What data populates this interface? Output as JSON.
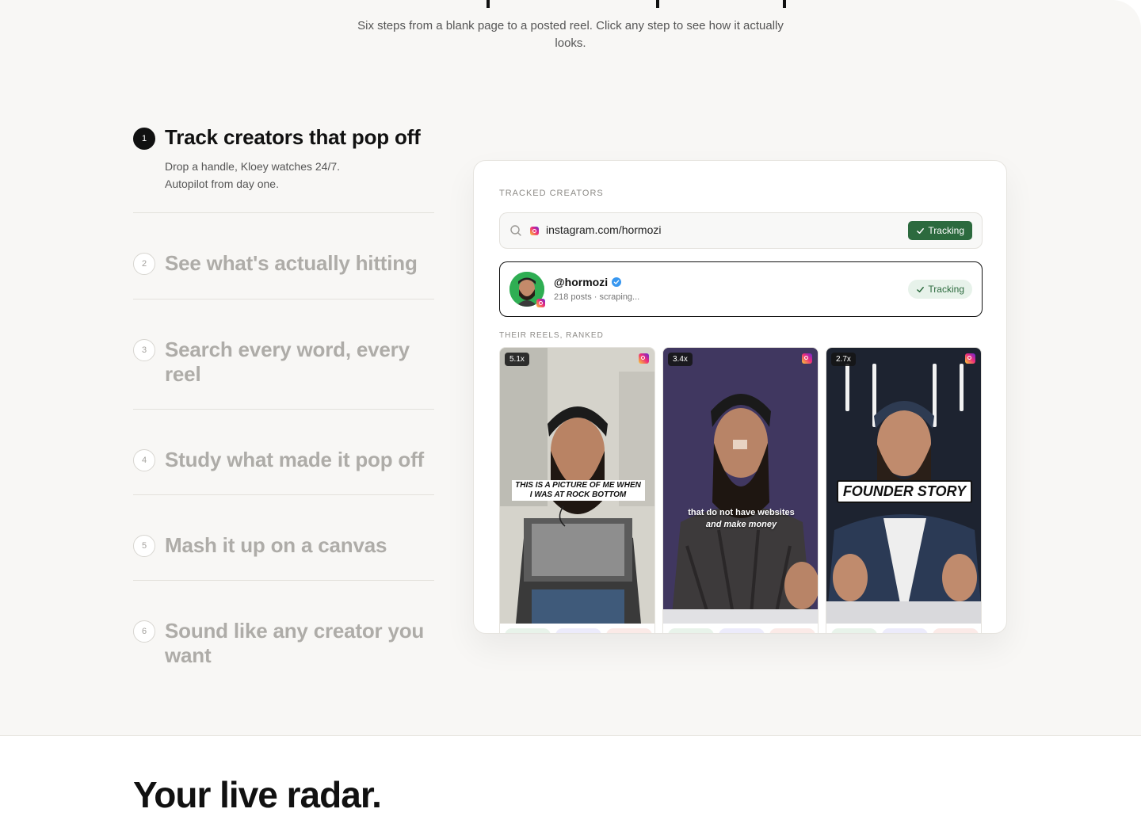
{
  "header": {
    "subtitle": "Six steps from a blank page to a posted reel. Click any step to see how it actually looks."
  },
  "steps": [
    {
      "num": "1",
      "title": "Track creators that pop off",
      "desc_line1": "Drop a handle, Kloey watches 24/7.",
      "desc_line2": "Autopilot from day one.",
      "active": true
    },
    {
      "num": "2",
      "title": "See what's actually hitting"
    },
    {
      "num": "3",
      "title": "Search every word, every reel"
    },
    {
      "num": "4",
      "title": "Study what made it pop off"
    },
    {
      "num": "5",
      "title": "Mash it up on a canvas"
    },
    {
      "num": "6",
      "title": "Sound like any creator you want"
    }
  ],
  "panel": {
    "label": "TRACKED CREATORS",
    "search_value": "instagram.com/hormozi",
    "search_badge": "Tracking",
    "creator": {
      "handle": "@hormozi",
      "meta": "218 posts · scraping...",
      "badge": "Tracking"
    },
    "reels_label": "THEIR REELS, RANKED",
    "reels": [
      {
        "multiplier": "5.1x",
        "caption": "THIS IS A PICTURE OF ME WHEN I WAS AT ROCK BOTTOM"
      },
      {
        "multiplier": "3.4x",
        "caption_line1": "that do not have websites",
        "caption_line2": "and make money"
      },
      {
        "multiplier": "2.7x",
        "caption": "FOUNDER STORY"
      }
    ]
  },
  "next_section": {
    "title": "Your live radar."
  },
  "colors": {
    "accent_green": "#2c6a3e",
    "light_green": "#e7f2ea",
    "background": "#f8f7f5"
  }
}
